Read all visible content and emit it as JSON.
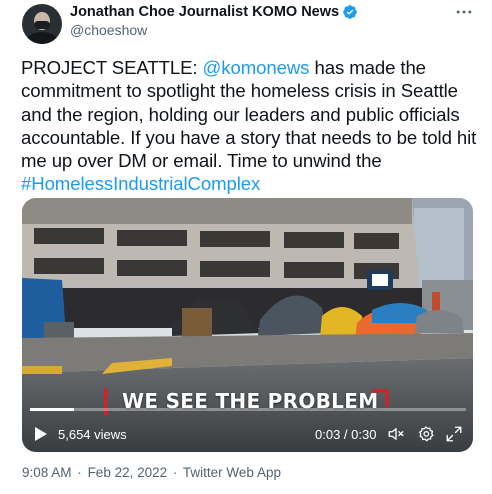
{
  "author": {
    "display_name": "Jonathan Choe Journalist KOMO News",
    "handle": "@choeshow",
    "verified": true
  },
  "tweet": {
    "segments": [
      {
        "text": "PROJECT SEATTLE: ",
        "type": "text"
      },
      {
        "text": "@komonews",
        "type": "link"
      },
      {
        "text": " has made the commitment to spotlight the homeless crisis in Seattle and the region, holding our leaders and public officials accountable. If you have a story that needs to be told hit me up over DM or email. Time to unwind the ",
        "type": "text"
      },
      {
        "text": "#HomelessIndustrialComplex",
        "type": "link"
      }
    ]
  },
  "video": {
    "caption": "WE SEE THE PROBLEM",
    "views": "5,654 views",
    "time": "0:03 / 0:30",
    "progress": 0.1,
    "icons": [
      "play-icon",
      "mute-icon",
      "settings-icon",
      "fullscreen-icon"
    ]
  },
  "meta": {
    "time": "9:08 AM",
    "date": "Feb 22, 2022",
    "source": "Twitter Web App",
    "separator": "·"
  },
  "colors": {
    "link": "#1d9bf0",
    "secondary_text": "#536471",
    "caption_accent": "#e01b22",
    "verified_badge": "#1d9bf0"
  }
}
